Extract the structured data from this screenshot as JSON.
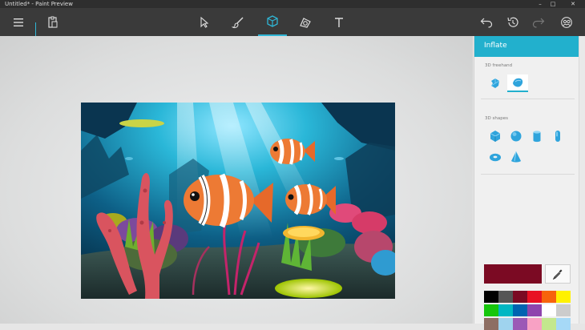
{
  "window": {
    "title": "Untitled* - Paint Preview",
    "controls": [
      "minimize",
      "maximize",
      "close"
    ]
  },
  "toolbar": {
    "left": [
      "hamburger-menu-icon",
      "paste-icon"
    ],
    "tools": [
      {
        "name": "select-tool",
        "active": false
      },
      {
        "name": "brush-tool",
        "active": false
      },
      {
        "name": "3d-objects-tool",
        "active": true
      },
      {
        "name": "stickers-tool",
        "active": false
      },
      {
        "name": "text-tool",
        "active": false,
        "glyph": "T"
      }
    ],
    "right": [
      "undo-icon",
      "history-icon",
      "redo-icon",
      "community-icon"
    ]
  },
  "panel": {
    "title": "Inflate",
    "freehand_label": "3D freehand",
    "freehand_tools": [
      {
        "icon": "sharp-edge-3d-icon",
        "selected": false
      },
      {
        "icon": "soft-edge-3d-icon",
        "selected": true
      }
    ],
    "shapes_label": "3D shapes",
    "shapes": [
      "cube-icon",
      "sphere-icon",
      "cylinder-icon",
      "capsule-icon",
      "donut-icon",
      "cone-icon"
    ],
    "current_color": "#7b0a23",
    "palette": [
      "#000000",
      "#555555",
      "#7b0a23",
      "#e81123",
      "#f7630c",
      "#fff100",
      "#16c60c",
      "#00b7c3",
      "#0063b1",
      "#8e44ad",
      "#ffffff",
      "#cccccc",
      "#8d6e63",
      "#9fd3ee",
      "#9b59b6",
      "#f8a1c4",
      "#c3e88d",
      "#a6d9f7"
    ]
  },
  "canvas": {
    "image": "underwater-clownfish-scene"
  }
}
